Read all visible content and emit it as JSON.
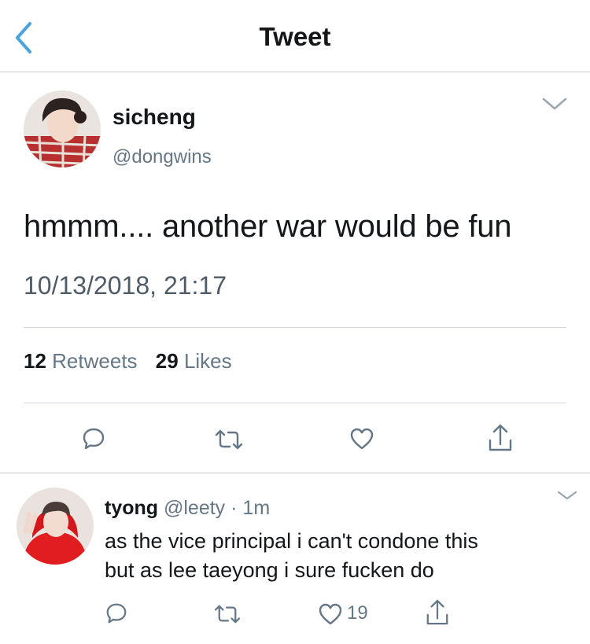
{
  "nav": {
    "title": "Tweet",
    "back_icon": "chevron-left-icon",
    "accent_color": "#4aa3df"
  },
  "tweet": {
    "name": "sicheng",
    "handle": "@dongwins",
    "text": "hmmm.... another war would be fun",
    "date": "10/13/2018, 21:17",
    "retweets": "12",
    "retweets_label": "Retweets",
    "likes": "29",
    "likes_label": "Likes",
    "actions": [
      "reply-icon",
      "retweet-icon",
      "like-icon",
      "share-icon"
    ]
  },
  "reply": {
    "name": "tyong",
    "handle": "@leety",
    "separator": "·",
    "time": "1m",
    "line1": "as the vice principal i can't condone this",
    "line2": "but as lee taeyong i sure fucken do",
    "like_count": "19",
    "actions": [
      "reply-icon",
      "retweet-icon",
      "like-icon",
      "share-icon"
    ]
  },
  "colors": {
    "text": "#14171a",
    "secondary": "#657786",
    "icon": "#657786",
    "divider": "#d4d8dc"
  }
}
